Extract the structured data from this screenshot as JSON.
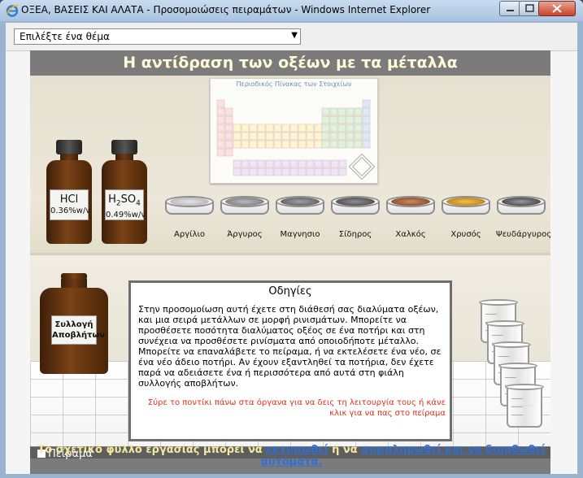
{
  "window": {
    "title": "ΟΞΕΑ, ΒΑΣΕΙΣ ΚΑΙ ΑΛΑΤΑ - Προσομοιώσεις πειραμάτων - Windows Internet Explorer"
  },
  "toolbar": {
    "topic_select": "Επιλέξτε ένα θέμα"
  },
  "experiment": {
    "title": "Η αντίδραση των οξέων με τα μέταλλα",
    "periodic_table_title": "Περιοδικός Πίνακας των Στοιχείων",
    "acids": [
      {
        "name": "HCl",
        "concentration": "0.36%w/v"
      },
      {
        "name": "H2SO4",
        "name_base": "H",
        "name_sub1": "2",
        "name_mid": "SO",
        "name_sub2": "4",
        "concentration": "0.49%w/v"
      }
    ],
    "metals": [
      {
        "label": "Αργίλιο",
        "color": "#c7c7c7"
      },
      {
        "label": "Άργυρος",
        "color": "#8a8a8a"
      },
      {
        "label": "Μαγνησιο",
        "color": "#6a6a6a"
      },
      {
        "label": "Σίδηρος",
        "color": "#5c5c5c"
      },
      {
        "label": "Χαλκός",
        "color": "#9c5a3a"
      },
      {
        "label": "Χρυσός",
        "color": "#d4982a"
      },
      {
        "label": "Ψευδάργυρος",
        "color": "#4a4a4a"
      }
    ],
    "waste_label_line1": "Συλλογή",
    "waste_label_line2": "Αποβλήτων",
    "instructions": {
      "title": "Οδηγίες",
      "paragraph1": "Στην προσομοίωση αυτή έχετε στη διάθεσή σας διαλύματα οξέων, και μια σειρά μετάλλων σε μορφή ρινισμάτων. Μπορείτε να προσθέσετε ποσότητα διαλύματος οξέος σε ένα ποτήρι και στη συνέχεια να προσθέσετε ρινίσματα από οποιοδήποτε μέταλλο.",
      "paragraph2": "Μπορείτε να επαναλάβετε το πείραμα, ή να εκτελέσετε ένα νέο, σε ένα νέο άδειο ποτήρι. Αν έχουν εξαντληθεί τα ποτήρια, δεν έχετε παρά να αδειάσετε ένα ή περισσότερα από αυτά στη φιάλη συλλογής αποβλήτων.",
      "hint": "Σύρε το ποντίκι πάνω στα όργανα για να δεις τη λειτουργία τους ή κάνε κλικ για να πας στο πείραμα"
    },
    "tab_label": "Πείραμα"
  },
  "footer": {
    "prefix": "Το σχετικό φύλλο εργασίας μπορεί να ",
    "print_link": "εκτυπωθεί",
    "middle": " ή να ",
    "fill_link": "συμπληρωθεί και να διορθωθεί αυτόματα."
  }
}
